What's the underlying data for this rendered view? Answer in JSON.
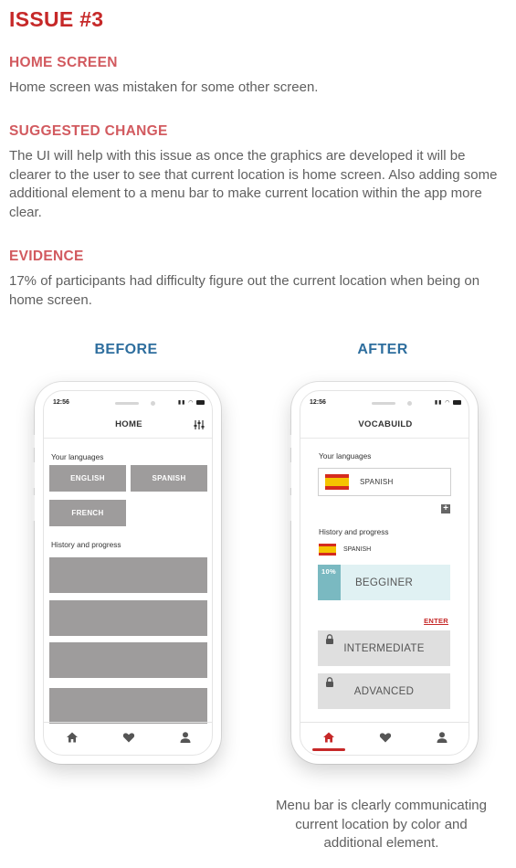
{
  "title": "ISSUE #3",
  "sections": [
    {
      "heading": "HOME SCREEN",
      "text": "Home screen was mistaken for some other screen."
    },
    {
      "heading": "SUGGESTED CHANGE",
      "text": "The UI will help with this issue as once the graphics are developed it will be clearer to the user to see that current location is home screen. Also adding some additional element to a menu bar to make current location within the app more clear."
    },
    {
      "heading": "EVIDENCE",
      "text": "17% of participants had difficulty figure out the current location when being on home screen."
    }
  ],
  "before": {
    "label": "BEFORE",
    "time": "12:56",
    "header": "HOME",
    "your_languages": "Your languages",
    "languages": [
      "ENGLISH",
      "SPANISH",
      "FRENCH"
    ],
    "history": "History and progress",
    "icons": {
      "settings": "sliders-icon",
      "home": "home-icon",
      "favorites": "heart-icon",
      "profile": "user-icon"
    }
  },
  "after": {
    "label": "AFTER",
    "time": "12:56",
    "header": "VOCABUILD",
    "your_languages": "Your languages",
    "language": "SPANISH",
    "history": "History and progress",
    "history_language": "SPANISH",
    "beginner": {
      "label": "BEGGINER",
      "progress_pct": "10%",
      "progress": 0.17
    },
    "enter": "ENTER",
    "intermediate": "INTERMEDIATE",
    "advanced": "ADVANCED",
    "colors": {
      "accent": "#c62828",
      "progress": "#7ab9c1",
      "progress_bg": "#e0f1f3"
    }
  },
  "caption": "Menu bar is clearly communicating current location by color and additional element."
}
